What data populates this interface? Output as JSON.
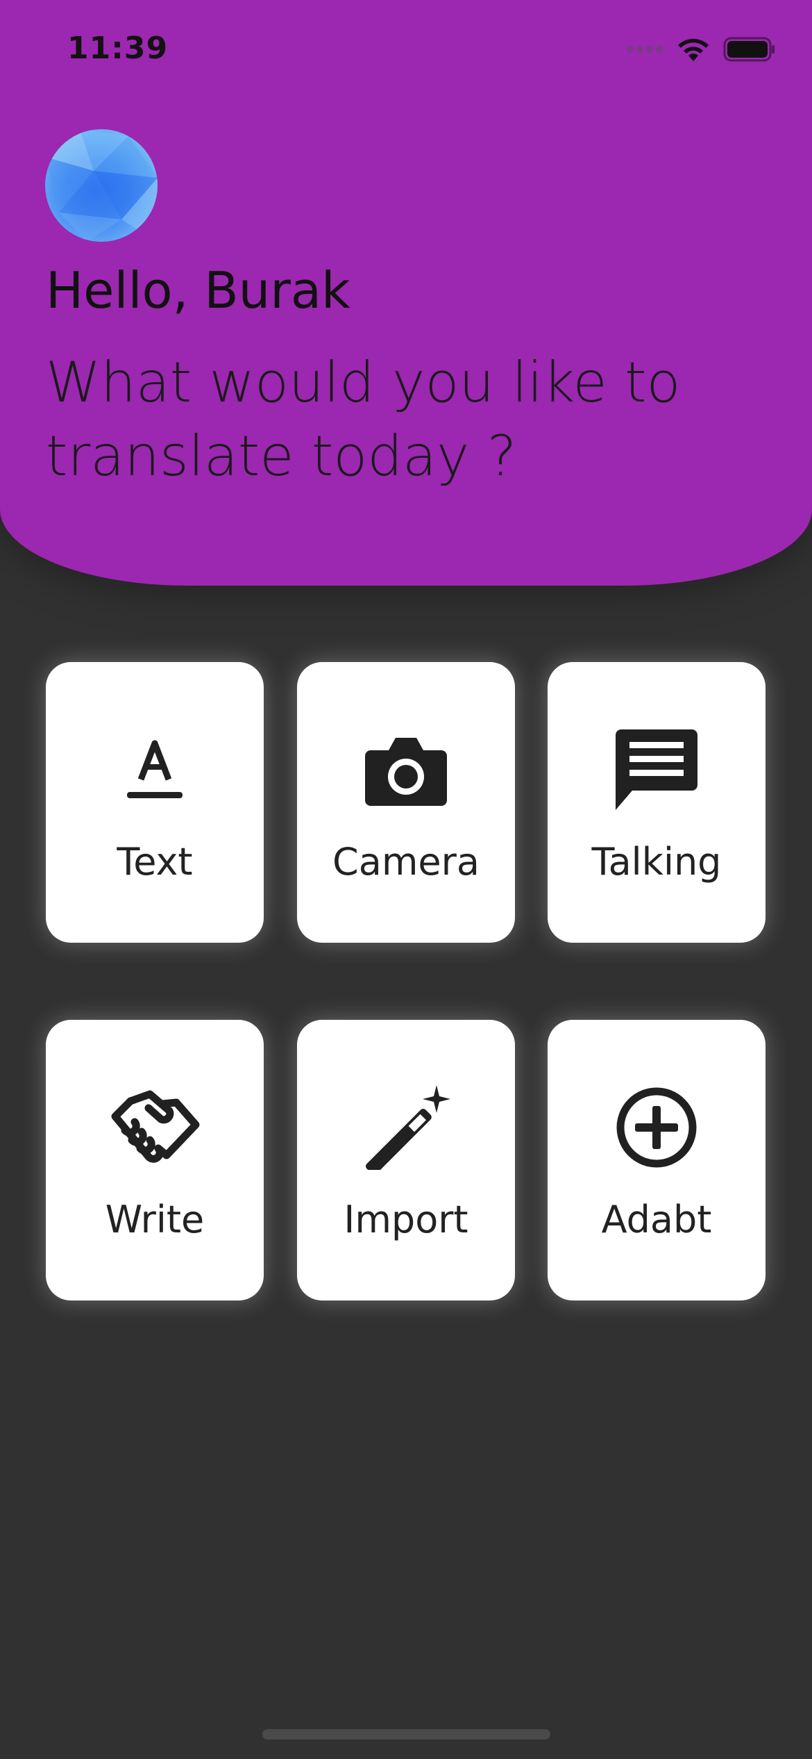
{
  "status_bar": {
    "time": "11:39"
  },
  "header": {
    "greeting": "Hello, Burak",
    "prompt": "What would you like to translate today ?",
    "background_color": "#9c27b0",
    "theme_toggle_icon": "moon-icon",
    "avatar": "avatar-image"
  },
  "tiles": [
    {
      "label": "Text",
      "icon": "text-format-icon"
    },
    {
      "label": "Camera",
      "icon": "camera-icon"
    },
    {
      "label": "Talking",
      "icon": "chat-bubble-icon"
    },
    {
      "label": "Write",
      "icon": "handshake-icon"
    },
    {
      "label": "Import",
      "icon": "magic-wand-icon"
    },
    {
      "label": "Adabt",
      "icon": "add-circle-icon"
    }
  ],
  "colors": {
    "page_background": "#313131",
    "tile_background": "#ffffff",
    "icon_color": "#212121"
  }
}
